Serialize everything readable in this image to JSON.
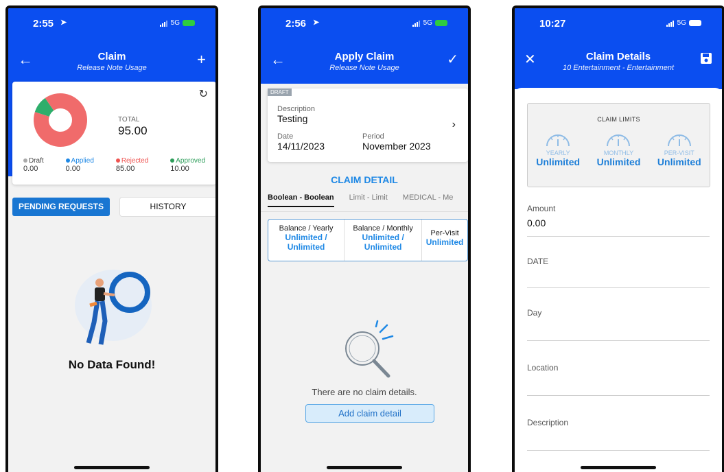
{
  "colors": {
    "brand_blue": "#0b4ef0",
    "draft": "#aaaaaa",
    "applied": "#1e88e5",
    "rejected": "#ef5350",
    "approved": "#2e9e5b",
    "link_blue": "#1e88e5"
  },
  "phone1": {
    "status_time": "2:55",
    "network": "5G",
    "title": "Claim",
    "subtitle": "Release Note Usage",
    "back_icon": "arrow-left-icon",
    "add_icon": "plus-icon",
    "refresh_icon": "refresh-icon",
    "chart_data": {
      "type": "pie",
      "categories": [
        "Draft",
        "Applied",
        "Rejected",
        "Approved"
      ],
      "values": [
        0.0,
        0.0,
        85.0,
        10.0
      ],
      "colors": [
        "#aaaaaa",
        "#1e88e5",
        "#f06b6b",
        "#2eae6b"
      ]
    },
    "total_label": "TOTAL",
    "total_value": "95.00",
    "legend": [
      {
        "label": "Draft",
        "value": "0.00",
        "color": "#aaaaaa"
      },
      {
        "label": "Applied",
        "value": "0.00",
        "color": "#1e88e5"
      },
      {
        "label": "Rejected",
        "value": "85.00",
        "color": "#ef5350"
      },
      {
        "label": "Approved",
        "value": "10.00",
        "color": "#2e9e5b"
      }
    ],
    "tab_pending": "PENDING REQUESTS",
    "tab_history": "HISTORY",
    "empty_text": "No Data Found!"
  },
  "phone2": {
    "status_time": "2:56",
    "network": "5G",
    "title": "Apply Claim",
    "subtitle": "Release Note Usage",
    "back_icon": "arrow-left-icon",
    "confirm_icon": "checkmark-icon",
    "draft_badge": "DRAFT",
    "description_label": "Description",
    "description_value": "Testing",
    "date_label": "Date",
    "date_value": "14/11/2023",
    "period_label": "Period",
    "period_value": "November 2023",
    "section_title": "CLAIM DETAIL",
    "tabs": [
      "Boolean - Boolean",
      "Limit - Limit",
      "MEDICAL - Me"
    ],
    "limits": [
      {
        "label": "Balance / Yearly",
        "line1": "Unlimited /",
        "line2": "Unlimited"
      },
      {
        "label": "Balance / Monthly",
        "line1": "Unlimited /",
        "line2": "Unlimited"
      },
      {
        "label": "Per-Visit",
        "line1": "Unlimited",
        "line2": ""
      }
    ],
    "empty_text": "There are no claim details.",
    "add_button": "Add claim detail"
  },
  "phone3": {
    "status_time": "10:27",
    "network": "5G",
    "title": "Claim Details",
    "subtitle": "10 Entertainment - Entertainment",
    "close_icon": "close-icon",
    "save_icon": "save-icon",
    "limits_title": "CLAIM LIMITS",
    "gauges": [
      {
        "name": "YEARLY",
        "value": "Unlimited"
      },
      {
        "name": "MONTHLY",
        "value": "Unlimited"
      },
      {
        "name": "PER-VISIT",
        "value": "Unlimited"
      }
    ],
    "amount_label": "Amount",
    "amount_value": "0.00",
    "date_label": "DATE",
    "day_label": "Day",
    "location_label": "Location",
    "description_label": "Description"
  }
}
